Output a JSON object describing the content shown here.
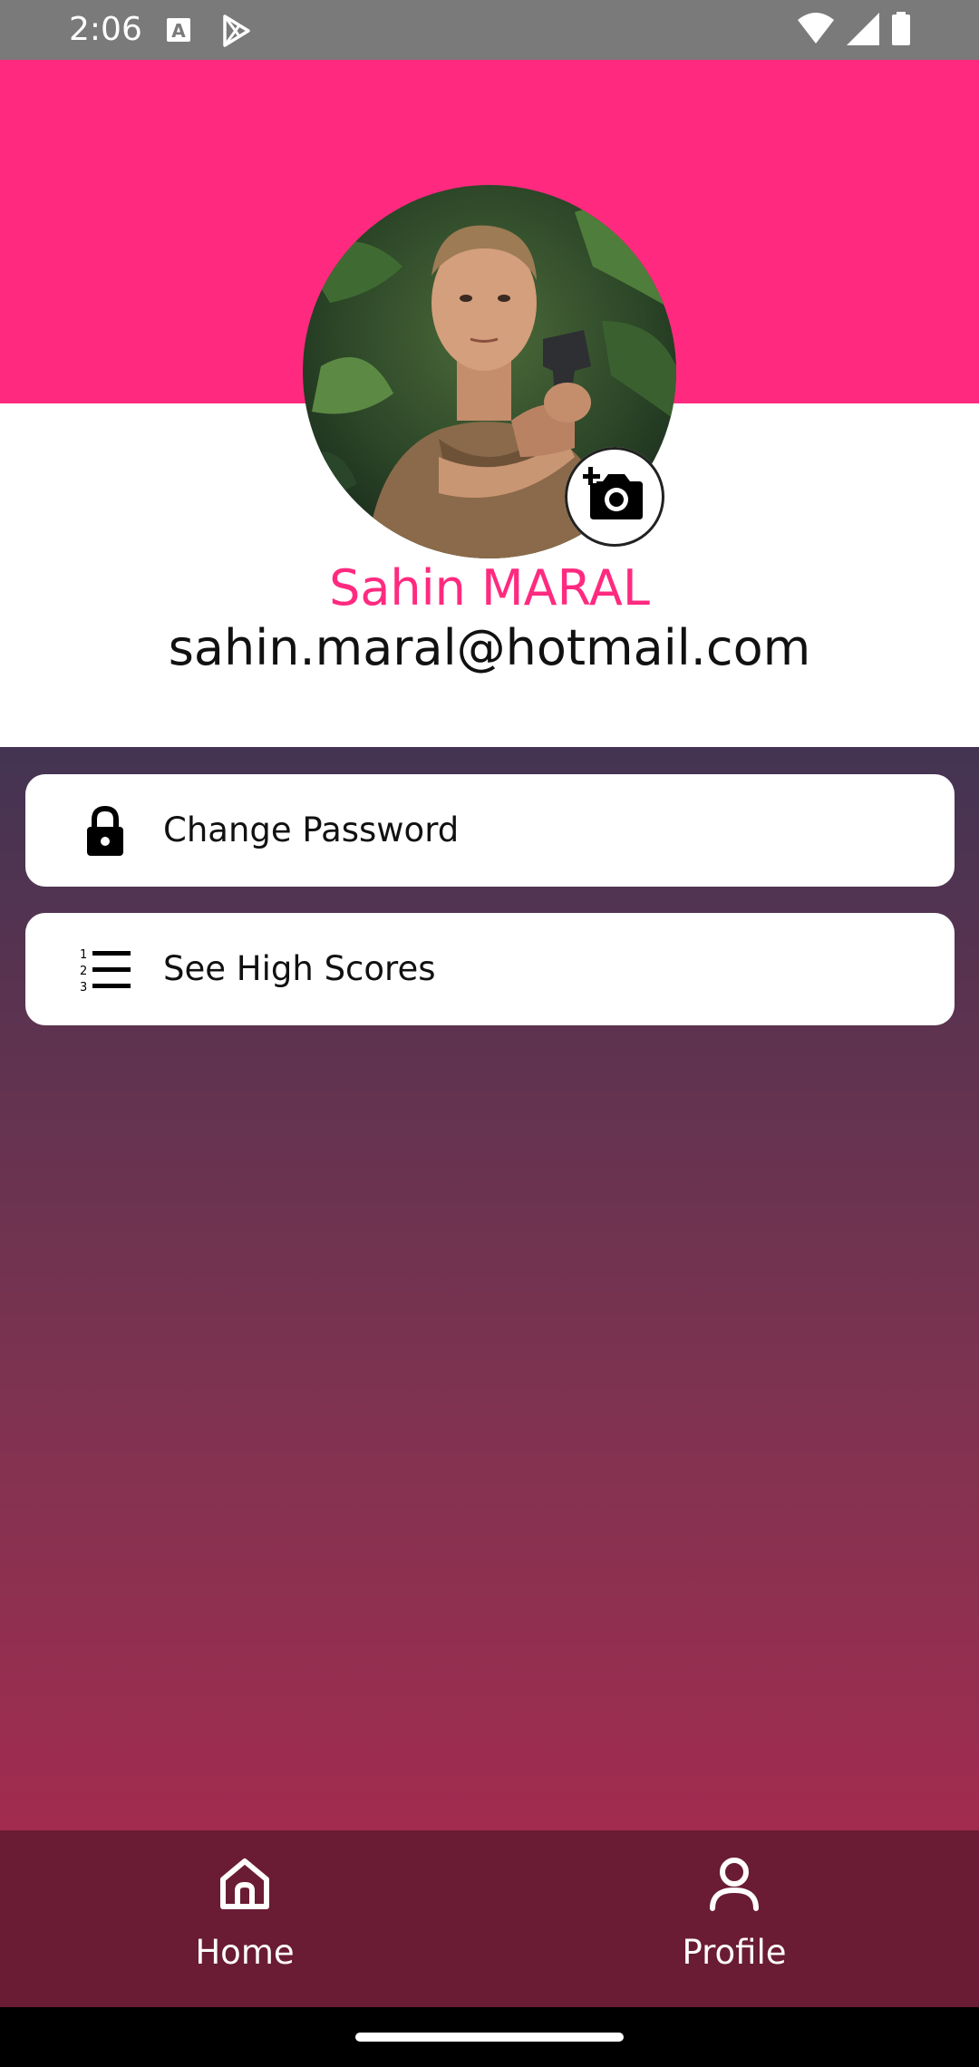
{
  "status_bar": {
    "time": "2:06",
    "icons": [
      "text-a-notification-icon",
      "play-store-icon",
      "wifi-icon",
      "signal-icon",
      "battery-icon"
    ]
  },
  "theme": {
    "accent": "#ff2a7f",
    "nav_background": "#6a1c34",
    "gradient_top": "#433452",
    "gradient_bottom": "#a22c50"
  },
  "profile": {
    "name": "Sahin MARAL",
    "email": "sahin.maral@hotmail.com",
    "avatar_icon": "profile-photo",
    "camera_icon": "add-photo-camera-icon"
  },
  "menu": {
    "items": [
      {
        "label": "Change Password",
        "icon": "lock-icon"
      },
      {
        "label": "See High Scores",
        "icon": "numbered-list-icon"
      }
    ]
  },
  "bottom_nav": {
    "items": [
      {
        "label": "Home",
        "icon": "home-icon",
        "active": false
      },
      {
        "label": "Profile",
        "icon": "person-icon",
        "active": true
      }
    ]
  }
}
